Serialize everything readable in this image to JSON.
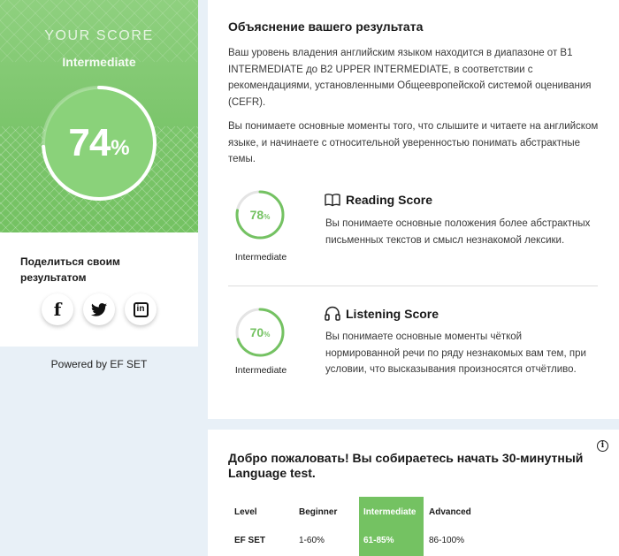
{
  "score_card": {
    "heading": "YOUR SCORE",
    "level": "Intermediate",
    "percent": 74,
    "percent_symbol": "%",
    "accent_color": "#74c262"
  },
  "share": {
    "title": "Поделиться своим результатом",
    "icons": [
      "facebook-icon",
      "twitter-icon",
      "linkedin-icon"
    ],
    "facebook_glyph": "f",
    "linkedin_glyph": "in"
  },
  "powered_by": "Powered by EF SET",
  "explanation": {
    "title": "Объяснение вашего результата",
    "paragraph_1": "Ваш уровень владения английским языком находится в диапазоне от B1 INTERMEDIATE до B2 UPPER INTERMEDIATE, в соответствии с рекомендациями, установленными Общеевропейской системой оценивания (CEFR).",
    "paragraph_2": "Вы понимаете основные моменты того, что слышите и читаете на английском языке, и начинаете с относительной уверенностью понимать абстрактные темы."
  },
  "skills": [
    {
      "title": "Reading Score",
      "percent": 78,
      "percent_symbol": "%",
      "level": "Intermediate",
      "icon": "book-icon",
      "description": "Вы понимаете основные положения более абстрактных письменных текстов и смысл незнакомой лексики."
    },
    {
      "title": "Listening Score",
      "percent": 70,
      "percent_symbol": "%",
      "level": "Intermediate",
      "icon": "headphones-icon",
      "description": "Вы понимаете основные моменты чёткой нормированной речи по ряду незнакомых вам тем, при условии, что высказывания произносятся отчётливо."
    }
  ],
  "welcome": {
    "title": "Добро пожаловать! Вы собираетесь начать 30-минутный Language test.",
    "info_glyph": "i",
    "table": {
      "headers": [
        "Level",
        "Beginner",
        "Intermediate",
        "Advanced"
      ],
      "row": [
        "EF SET",
        "1-60%",
        "61-85%",
        "86-100%"
      ],
      "highlighted_column": 2
    }
  }
}
